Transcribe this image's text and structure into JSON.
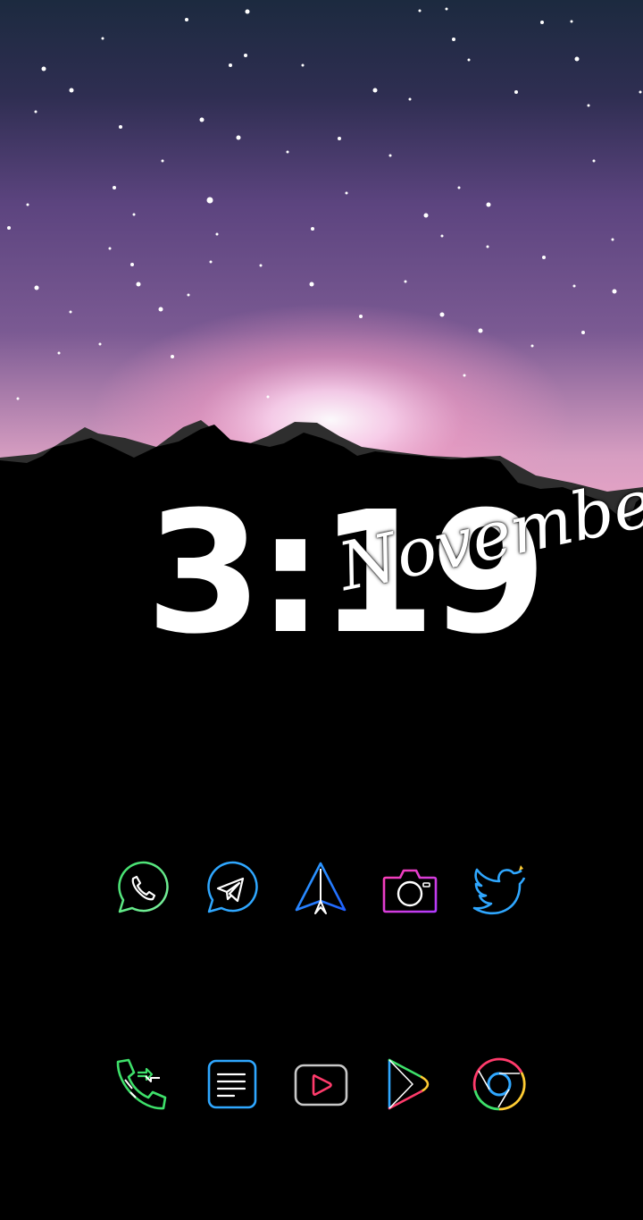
{
  "lockscreen": {
    "time": "3:19",
    "month": "November"
  },
  "home_row_1": [
    {
      "name": "whatsapp-icon",
      "label": ""
    },
    {
      "name": "telegram-icon",
      "label": ""
    },
    {
      "name": "paper-plane-icon",
      "label": ""
    },
    {
      "name": "camera-icon",
      "label": ""
    },
    {
      "name": "twitter-icon",
      "label": ""
    }
  ],
  "home_row_2": [
    {
      "name": "phone-dialer-icon",
      "label": ""
    },
    {
      "name": "notes-icon",
      "label": ""
    },
    {
      "name": "youtube-icon",
      "label": ""
    },
    {
      "name": "play-store-icon",
      "label": ""
    },
    {
      "name": "chrome-icon",
      "label": ""
    }
  ],
  "colors": {
    "sky_top": "#1c2a3f",
    "sky_mid": "#6a4d88",
    "glow": "#f2a6c7",
    "mountain": "#000000",
    "mountain_ridge": "#2b2b2b",
    "green": "#3ee06a",
    "blue": "#2fa7ff",
    "magenta": "#d63bff",
    "yellow": "#ffcc33"
  }
}
